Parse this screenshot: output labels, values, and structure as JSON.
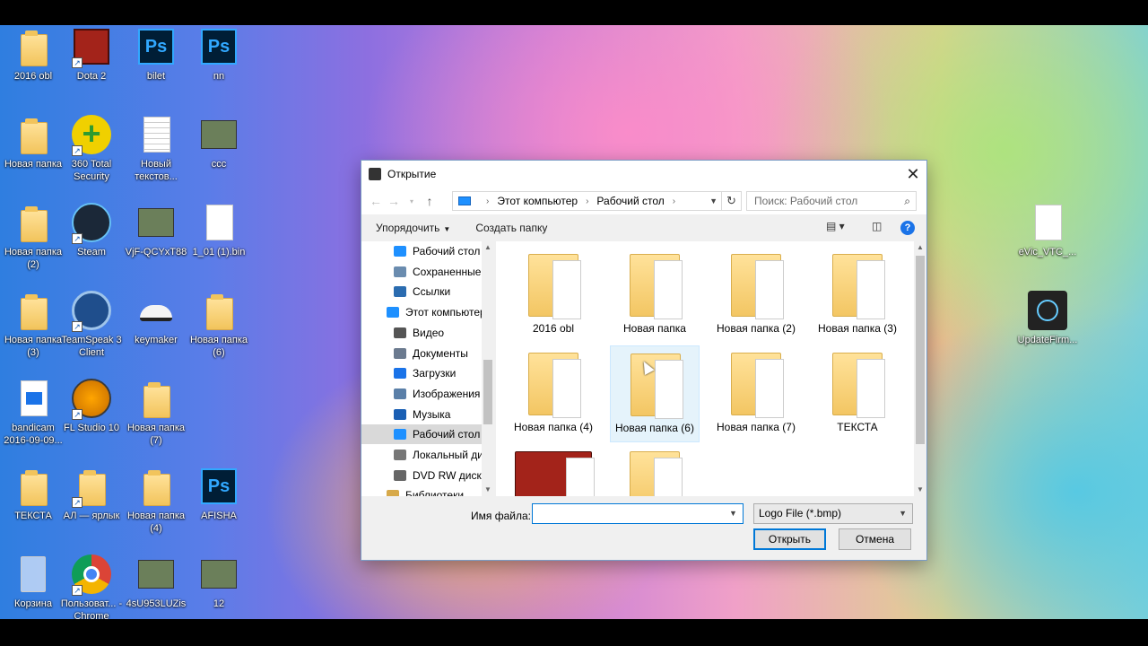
{
  "desktop_icons": [
    {
      "label": "2016 obl",
      "icon": "folder-icon"
    },
    {
      "label": "Dota 2",
      "icon": "dota-icon",
      "shortcut": true
    },
    {
      "label": "bilet",
      "icon": "photoshop-icon"
    },
    {
      "label": "nn",
      "icon": "photoshop-icon"
    },
    {
      "label": "Новая папка",
      "icon": "folder-icon"
    },
    {
      "label": "360 Total Security",
      "icon": "security-plus-icon",
      "shortcut": true
    },
    {
      "label": "Новый текстов...",
      "icon": "text-document-icon"
    },
    {
      "label": "ccc",
      "icon": "image-icon"
    },
    {
      "label": "Новая папка (2)",
      "icon": "folder-icon"
    },
    {
      "label": "Steam",
      "icon": "steam-icon",
      "shortcut": true
    },
    {
      "label": "VjF-QCYxT88",
      "icon": "image-icon"
    },
    {
      "label": "1_01 (1).bin",
      "icon": "file-icon"
    },
    {
      "label": "Новая папка (3)",
      "icon": "folder-icon"
    },
    {
      "label": "TeamSpeak 3 Client",
      "icon": "teamspeak-icon",
      "shortcut": true
    },
    {
      "label": "keymaker",
      "icon": "hat-icon"
    },
    {
      "label": "Новая папка (6)",
      "icon": "folder-icon"
    },
    {
      "label": "bandicam 2016-09-09...",
      "icon": "video-file-icon"
    },
    {
      "label": "FL Studio 10",
      "icon": "fl-studio-icon",
      "shortcut": true
    },
    {
      "label": "Новая папка (7)",
      "icon": "folder-icon"
    },
    {
      "label": "ТЕКСТА",
      "icon": "folder-icon"
    },
    {
      "label": "АЛ — ярлык",
      "icon": "folder-icon",
      "shortcut": true
    },
    {
      "label": "Новая папка (4)",
      "icon": "folder-icon"
    },
    {
      "label": "AFISHA",
      "icon": "photoshop-icon"
    },
    {
      "label": "Корзина",
      "icon": "recycle-bin-icon"
    },
    {
      "label": "Пользоват... - Chrome",
      "icon": "chrome-icon",
      "shortcut": true
    },
    {
      "label": "4sU953LUZis",
      "icon": "image-icon"
    },
    {
      "label": "12",
      "icon": "image-icon"
    },
    {
      "label": "eVic_VTC_...",
      "icon": "file-icon"
    },
    {
      "label": "UpdateFirm...",
      "icon": "vt-app-icon"
    }
  ],
  "dialog": {
    "title": "Открытие",
    "breadcrumb": [
      "Этот компьютер",
      "Рабочий стол"
    ],
    "search_placeholder": "Поиск: Рабочий стол",
    "toolbar": {
      "organize": "Упорядочить",
      "new_folder": "Создать папку"
    },
    "nav_items": [
      {
        "label": "Рабочий стол",
        "color": "#1e90ff"
      },
      {
        "label": "Сохраненные",
        "color": "#6a8caf"
      },
      {
        "label": "Ссылки",
        "color": "#2b6cb0"
      },
      {
        "label": "Этот компьютер",
        "color": "#1e90ff"
      },
      {
        "label": "Видео",
        "color": "#555555"
      },
      {
        "label": "Документы",
        "color": "#6b7a8f"
      },
      {
        "label": "Загрузки",
        "color": "#1a73e8"
      },
      {
        "label": "Изображения",
        "color": "#5a7fa8"
      },
      {
        "label": "Музыка",
        "color": "#1a5fb4"
      },
      {
        "label": "Рабочий стол",
        "color": "#1e90ff",
        "selected": true
      },
      {
        "label": "Локальный диск",
        "color": "#777777"
      },
      {
        "label": "DVD RW дисковод",
        "color": "#666666"
      },
      {
        "label": "Библиотеки",
        "color": "#d7a94a"
      }
    ],
    "files": [
      {
        "label": "2016 obl"
      },
      {
        "label": "Новая папка"
      },
      {
        "label": "Новая папка (2)"
      },
      {
        "label": "Новая папка (3)"
      },
      {
        "label": "Новая папка (4)"
      },
      {
        "label": "Новая папка (6)",
        "hover": true
      },
      {
        "label": "Новая папка (7)"
      },
      {
        "label": "ТЕКСТА"
      },
      {
        "label": ""
      },
      {
        "label": ""
      }
    ],
    "filename_label": "Имя файла:",
    "filename_value": "",
    "filetype": "Logo File (*.bmp)",
    "open_button": "Открыть",
    "cancel_button": "Отмена"
  }
}
